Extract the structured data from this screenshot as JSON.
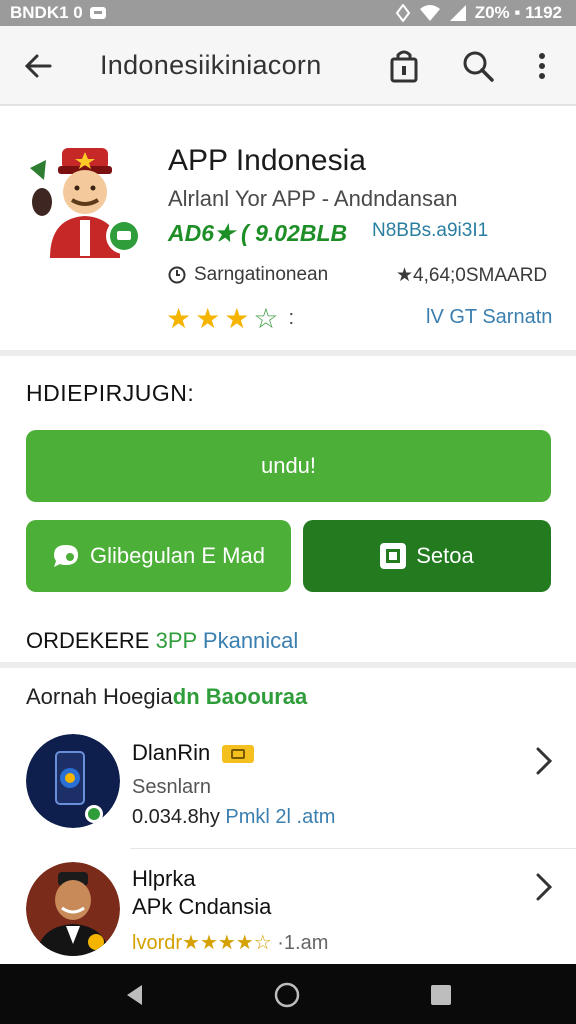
{
  "status_bar": {
    "left_text": "BNDK1 0",
    "right_text": "Z0% ▪ 1192"
  },
  "app_bar": {
    "title": "Indonesiikiniacorn"
  },
  "app": {
    "name": "APP Indonesia",
    "subtitle": "Alrlanl Yor  APP - Andndansan",
    "version": "AD6★ ( 9.02BLB",
    "code": "N8BBs.a9i3I1",
    "info_left": "Sarngatinonean",
    "info_right": "★4,64;0SMAARD",
    "rating": 3.5,
    "rating_suffix": ":",
    "link": "GT Sarnatn",
    "link_prefix": "lV"
  },
  "section_title": "HDIEPIRJUGN:",
  "buttons": {
    "primary": "undu!",
    "secondary": "Glibegulan E Mad",
    "tertiary": "Setoa"
  },
  "sub_heading": {
    "part1": "ORDEKERE ",
    "part2": "3PP ",
    "part3": "Pkannical"
  },
  "list_heading": {
    "part1": "Aornah Hoegia",
    "part2": "dn Baoouraa"
  },
  "list_items": [
    {
      "title": "DlanRin",
      "line2": "Sesnlarn",
      "meta1": "0.034.8hy ",
      "meta2": "Pmkl 2l .atm"
    },
    {
      "title": "Hlprka",
      "line2": "APk Cndansia",
      "meta1": "lvordr★★★★☆",
      "meta2": " ·1.am"
    }
  ],
  "colors": {
    "green": "#4caf38",
    "dark_green": "#237a1f",
    "star": "#f4b400",
    "link_blue": "#3b7fb0"
  },
  "icons": [
    "back-arrow-icon",
    "gift-bag-icon",
    "search-icon",
    "more-vert-icon",
    "clock-icon",
    "star-icon",
    "chevron-right-icon",
    "nav-back-icon",
    "nav-home-icon",
    "nav-recents-icon"
  ]
}
